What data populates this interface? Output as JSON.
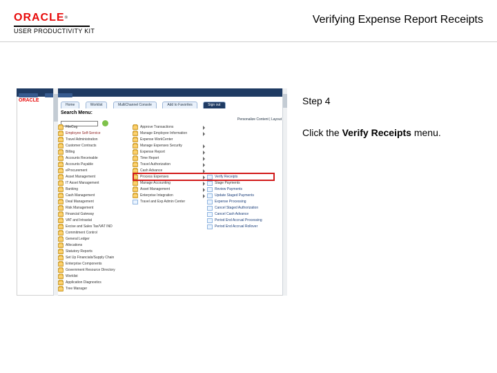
{
  "doc_title": "Verifying Expense Report Receipts",
  "logo": {
    "brand": "ORACLE",
    "tm": "®",
    "subtitle": "USER PRODUCTIVITY KIT"
  },
  "instruction": {
    "step_label": "Step 4",
    "prefix": "Click the ",
    "bold": "Verify Receipts",
    "suffix": " menu."
  },
  "topbar": {
    "chips": [
      "Favorites",
      "Main Menu"
    ],
    "tabs": [
      "Home",
      "Worklist",
      "MultiChannel Console",
      "Add to Favorites",
      "Sign out"
    ],
    "search_label": "Search Menu:",
    "personalize": "Personalize Content | Layout"
  },
  "col1": [
    {
      "t": "FileCog",
      "sel": false
    },
    {
      "t": "Employee Self-Service",
      "sel": true
    },
    {
      "t": "Travel Administration",
      "sel": false
    },
    {
      "t": "Customer Contracts",
      "sel": false
    },
    {
      "t": "Billing",
      "sel": false
    },
    {
      "t": "Accounts Receivable",
      "sel": false
    },
    {
      "t": "Accounts Payable",
      "sel": false
    },
    {
      "t": "eProcurement",
      "sel": false
    },
    {
      "t": "Asset Management",
      "sel": false
    },
    {
      "t": "IT Asset Management",
      "sel": false
    },
    {
      "t": "Banking",
      "sel": false
    },
    {
      "t": "Cash Management",
      "sel": false
    },
    {
      "t": "Deal Management",
      "sel": false
    },
    {
      "t": "Risk Management",
      "sel": false
    },
    {
      "t": "Financial Gateway",
      "sel": false
    },
    {
      "t": "VAT and Intrastat",
      "sel": false
    },
    {
      "t": "Excise and Sales Tax/VAT IND",
      "sel": false
    },
    {
      "t": "Commitment Control",
      "sel": false
    },
    {
      "t": "General Ledger",
      "sel": false
    },
    {
      "t": "Allocations",
      "sel": false
    },
    {
      "t": "Statutory Reports",
      "sel": false
    },
    {
      "t": "Set Up Financials/Supply Chain",
      "sel": false
    },
    {
      "t": "Enterprise Components",
      "sel": false
    },
    {
      "t": "Government Resource Directory",
      "sel": false
    },
    {
      "t": "Worklist",
      "sel": false
    },
    {
      "t": "Application Diagnostics",
      "sel": false
    },
    {
      "t": "Tree Manager",
      "sel": false
    }
  ],
  "col2": [
    {
      "t": "Approve Transactions",
      "ic": "folder",
      "arr": true
    },
    {
      "t": "Manage Employee Information",
      "ic": "folder",
      "arr": true
    },
    {
      "t": "Expense WorkCenter",
      "ic": "folder",
      "arr": false
    },
    {
      "t": "Manage Expenses Security",
      "ic": "folder",
      "arr": true
    },
    {
      "t": "Expense Report",
      "ic": "folder",
      "arr": true
    },
    {
      "t": "Time Report",
      "ic": "folder",
      "arr": true
    },
    {
      "t": "Travel Authorization",
      "ic": "folder",
      "arr": true
    },
    {
      "t": "Cash Advance",
      "ic": "folder",
      "arr": true
    },
    {
      "t": "Process Expenses",
      "ic": "folder",
      "arr": true,
      "hl": true
    },
    {
      "t": "Manage Accounting",
      "ic": "folder",
      "arr": true
    },
    {
      "t": "Asset Management",
      "ic": "folder",
      "arr": true
    },
    {
      "t": "Enterprise Integration",
      "ic": "folder",
      "arr": true
    },
    {
      "t": "Travel and Exp Admin Center",
      "ic": "doc",
      "arr": false
    }
  ],
  "col3": [
    {
      "t": "Verify Receipts",
      "link": true
    },
    {
      "t": "Stage Payments",
      "link": false
    },
    {
      "t": "Review Payments",
      "link": true
    },
    {
      "t": "Update Staged Payments",
      "link": true
    },
    {
      "t": "Expense Processing",
      "link": true
    },
    {
      "t": "Cancel Staged Authorization",
      "link": true
    },
    {
      "t": "Cancel Cash Advance",
      "link": true
    },
    {
      "t": "Period End Accrual Processing",
      "link": true
    },
    {
      "t": "Period End Accrual Rollover",
      "link": true
    }
  ]
}
